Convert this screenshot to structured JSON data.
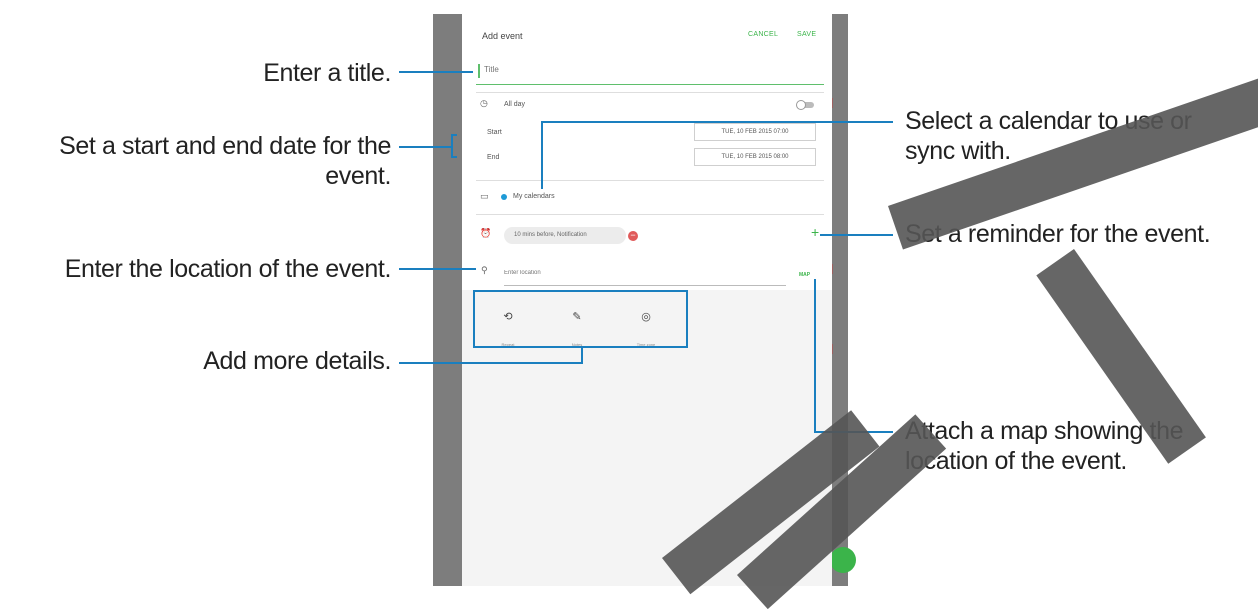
{
  "header": {
    "title": "Add event",
    "cancel_label": "CANCEL",
    "save_label": "SAVE"
  },
  "title_field": {
    "placeholder": "Title"
  },
  "all_day": {
    "label": "All day",
    "enabled": false
  },
  "start": {
    "label": "Start",
    "value": "TUE, 10 FEB 2015  07:00"
  },
  "end": {
    "label": "End",
    "value": "TUE, 10 FEB 2015  08:00"
  },
  "calendar": {
    "label": "My calendars",
    "color": "#1e9ad6"
  },
  "reminder": {
    "chip_label": "10 mins before, Notification"
  },
  "location": {
    "placeholder": "Enter location",
    "map_label": "MAP"
  },
  "details": [
    {
      "icon": "repeat-icon",
      "label": "Repeat"
    },
    {
      "icon": "notes-icon",
      "label": "Notes"
    },
    {
      "icon": "time-zone-icon",
      "label": "Time zone"
    }
  ],
  "annotations": {
    "title": "Enter a title.",
    "dates": "Set a start and end date for the event.",
    "location": "Enter the location of the event.",
    "details": "Add more details.",
    "calendar": "Select a calendar to use or sync with.",
    "reminder": "Set a reminder for the event.",
    "map": "Attach a map showing the location of the event."
  },
  "colors": {
    "accent": "#3bb44a",
    "callout": "#1a7fbf",
    "calendar_dot": "#1e9ad6"
  }
}
